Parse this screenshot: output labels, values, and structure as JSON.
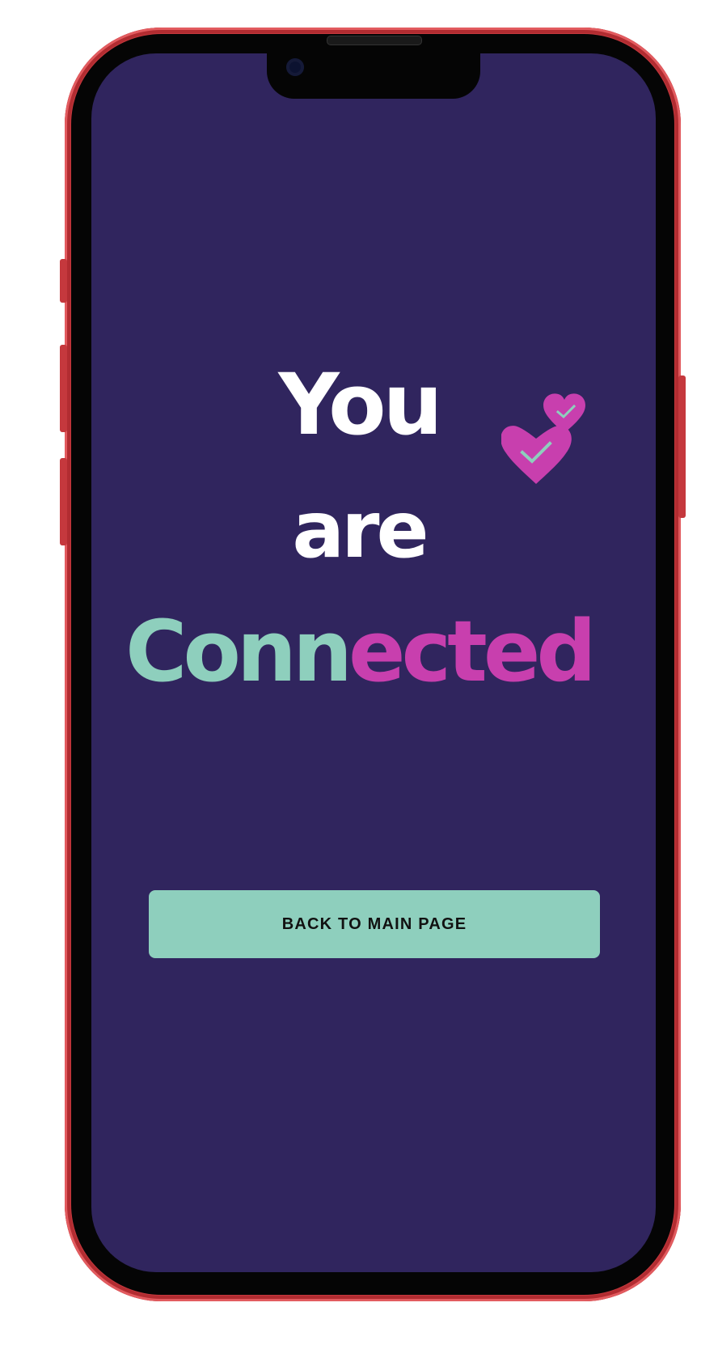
{
  "screen": {
    "headline": {
      "line1": "You",
      "line2": "are",
      "line3_part1": "Conn",
      "line3_part2": "ected"
    },
    "cta_label": "BACK TO MAIN PAGE"
  },
  "colors": {
    "background": "#30255e",
    "accent_teal": "#8ecfbd",
    "accent_magenta": "#c83fae",
    "frame_red": "#c5383d"
  },
  "icons": {
    "hearts": "heart-check-icon"
  }
}
